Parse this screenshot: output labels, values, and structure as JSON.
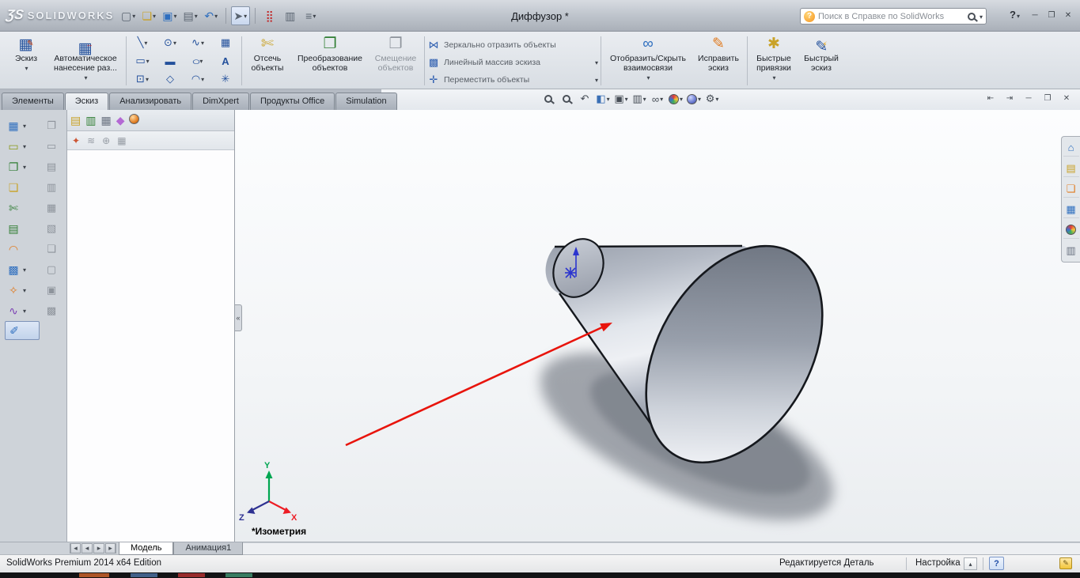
{
  "colors": {
    "arrow_red": "#e8140c",
    "axis_x": "#ed1c24",
    "axis_y": "#00a651",
    "axis_z": "#2e3192",
    "selection_blue": "#2b35cf",
    "accent_orange": "#f7941d"
  },
  "titlebar": {
    "logo_mark": "ƷS",
    "logo_text": "SOLIDWORKS",
    "document_title": "Диффузор *",
    "search_placeholder": "Поиск в Справке по SolidWorks",
    "search_ball": "?",
    "help_label": "?",
    "window_buttons": [
      {
        "name": "minimize",
        "glyph": "─"
      },
      {
        "name": "restore",
        "glyph": "❐"
      },
      {
        "name": "close",
        "glyph": "✕"
      }
    ]
  },
  "quick_toolbar": {
    "items": [
      {
        "name": "new-document",
        "glyph": "▢"
      },
      {
        "name": "open",
        "glyph": "❏"
      },
      {
        "name": "save",
        "glyph": "▣"
      },
      {
        "name": "print",
        "glyph": "▤"
      },
      {
        "name": "undo",
        "glyph": "↶"
      },
      {
        "name": "select",
        "glyph": "➤"
      },
      {
        "name": "rebuild",
        "glyph": "⣿"
      },
      {
        "name": "file-properties",
        "glyph": "▥"
      },
      {
        "name": "options",
        "glyph": "≡"
      }
    ]
  },
  "ribbon": {
    "sketch": {
      "label": "Эскиз",
      "glyph": "▦"
    },
    "auto_dimension": {
      "label": "Автоматическое нанесение раз...",
      "glyph": "▦"
    },
    "tool_grid": [
      {
        "name": "line-tool",
        "glyph": "╲"
      },
      {
        "name": "circle-tool",
        "glyph": "⊙"
      },
      {
        "name": "spline-tool",
        "glyph": "∿"
      },
      {
        "name": "sketch-picture-tool",
        "glyph": "▦"
      },
      {
        "name": "rectangle-tool",
        "glyph": "▭"
      },
      {
        "name": "slot-tool",
        "glyph": "▬"
      },
      {
        "name": "ellipse-tool",
        "glyph": "○"
      },
      {
        "name": "text-tool",
        "glyph": "А"
      },
      {
        "name": "plane-tool",
        "glyph": "⊡"
      },
      {
        "name": "polygon-tool",
        "glyph": "◇"
      },
      {
        "name": "arc-tool",
        "glyph": "◠"
      },
      {
        "name": "point-tool",
        "glyph": "✳"
      }
    ],
    "trim": {
      "label": "Отсечь объекты",
      "glyph": "✄"
    },
    "convert": {
      "label": "Преобразование объектов",
      "glyph": "❐"
    },
    "offset": {
      "label": "Смещение объектов",
      "glyph": "❐"
    },
    "mirror": {
      "label": "Зеркально отразить объекты",
      "glyph": "⋈"
    },
    "linear_pattern": {
      "label": "Линейный массив эскиза",
      "glyph": "▩"
    },
    "move": {
      "label": "Переместить объекты",
      "glyph": "✛"
    },
    "relations": {
      "label": "Отобразить/Скрыть взаимосвязи",
      "glyph": "∞"
    },
    "repair": {
      "label": "Исправить эскиз",
      "glyph": "✎"
    },
    "quick_snaps": {
      "label": "Быстрые привязки",
      "glyph": "✱"
    },
    "rapid_sketch": {
      "label": "Быстрый эскиз",
      "glyph": "✎"
    }
  },
  "command_tabs": [
    {
      "label": "Элементы"
    },
    {
      "label": "Эскиз",
      "active": true
    },
    {
      "label": "Анализировать"
    },
    {
      "label": "DimXpert"
    },
    {
      "label": "Продукты Office"
    },
    {
      "label": "Simulation"
    }
  ],
  "headsup": {
    "items": [
      {
        "name": "zoom-fit"
      },
      {
        "name": "zoom-area"
      },
      {
        "name": "previous-view",
        "glyph": "↶"
      },
      {
        "name": "section-view",
        "glyph": "◧"
      },
      {
        "name": "view-orientation",
        "glyph": "▣"
      },
      {
        "name": "display-style",
        "glyph": "▥"
      },
      {
        "name": "hide-show-items",
        "glyph": "∞"
      },
      {
        "name": "edit-appearance"
      },
      {
        "name": "apply-scene"
      },
      {
        "name": "view-settings",
        "glyph": "⚙"
      }
    ]
  },
  "window_controls": [
    {
      "name": "pane-left",
      "glyph": "⇤"
    },
    {
      "name": "pane-right",
      "glyph": "⇥"
    },
    {
      "name": "minimize",
      "glyph": "─"
    },
    {
      "name": "restore",
      "glyph": "❐"
    },
    {
      "name": "close",
      "glyph": "✕"
    }
  ],
  "left_toolbar": {
    "col1": [
      {
        "name": "sketch-tool",
        "glyph": "▦"
      },
      {
        "name": "rectangle-tool",
        "glyph": "▭"
      },
      {
        "name": "convert-entities-tool",
        "glyph": "❐"
      },
      {
        "name": "offset-entities-tool",
        "glyph": "❏"
      },
      {
        "name": "trim-entities-tool",
        "glyph": "✄"
      },
      {
        "name": "surface-note-tool",
        "glyph": "▤"
      },
      {
        "name": "fillet-tool",
        "glyph": "◠"
      },
      {
        "name": "pattern-tool",
        "glyph": "▩"
      },
      {
        "name": "snaps-tool",
        "glyph": "✧"
      },
      {
        "name": "spline-tool",
        "glyph": "∿"
      },
      {
        "name": "smart-dimension-tool",
        "glyph": "✐"
      }
    ],
    "col2": [
      {
        "name": "sheet-tool-1",
        "glyph": "❐"
      },
      {
        "name": "sheet-tool-2",
        "glyph": "▭"
      },
      {
        "name": "sheet-tool-3",
        "glyph": "▤"
      },
      {
        "name": "sheet-tool-4",
        "glyph": "▥"
      },
      {
        "name": "sheet-tool-5",
        "glyph": "▦"
      },
      {
        "name": "sheet-tool-6",
        "glyph": "▧"
      },
      {
        "name": "sheet-tool-7",
        "glyph": "❏"
      },
      {
        "name": "sheet-tool-8",
        "glyph": "▢"
      },
      {
        "name": "sheet-tool-9",
        "glyph": "▣"
      },
      {
        "name": "sheet-tool-10",
        "glyph": "▩"
      }
    ]
  },
  "feature_panel": {
    "tabs": [
      {
        "name": "featuremanager-tree",
        "glyph": "▤"
      },
      {
        "name": "propertymanager",
        "glyph": "▥"
      },
      {
        "name": "configurationmanager",
        "glyph": "▦"
      },
      {
        "name": "dimxpertmanager",
        "glyph": "◆"
      },
      {
        "name": "displaymanager"
      }
    ],
    "subtoolbar": [
      {
        "name": "sensors",
        "glyph": "✦"
      },
      {
        "name": "history-filter",
        "glyph": "≋"
      },
      {
        "name": "expand-tree",
        "glyph": "⊕"
      },
      {
        "name": "display-pane",
        "glyph": "▦"
      }
    ]
  },
  "taskpane": {
    "items": [
      {
        "name": "resources-home",
        "glyph": "⌂"
      },
      {
        "name": "design-library",
        "glyph": "▤"
      },
      {
        "name": "file-explorer",
        "glyph": "❏"
      },
      {
        "name": "view-palette",
        "glyph": "▦"
      },
      {
        "name": "appearances-scenes"
      },
      {
        "name": "custom-properties",
        "glyph": "▥"
      }
    ]
  },
  "viewport": {
    "view_label": "*Изометрия",
    "triad": {
      "x": "X",
      "y": "Y",
      "z": "Z"
    }
  },
  "model_bar": {
    "nav": [
      {
        "name": "first-tab",
        "glyph": "◂"
      },
      {
        "name": "prev-tab",
        "glyph": "◂"
      },
      {
        "name": "next-tab",
        "glyph": "▸"
      },
      {
        "name": "last-tab",
        "glyph": "▸"
      }
    ],
    "tabs": [
      {
        "label": "Модель",
        "active": true
      },
      {
        "label": "Анимация1"
      }
    ]
  },
  "statusbar": {
    "product": "SolidWorks Premium 2014 x64 Edition",
    "edit_state": "Редактируется Деталь",
    "customize": "Настройка",
    "help": "?"
  }
}
